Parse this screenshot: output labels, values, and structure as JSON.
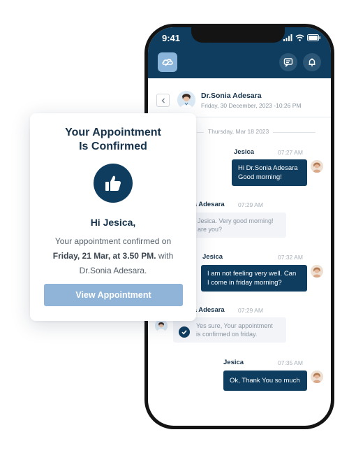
{
  "status_bar": {
    "time": "9:41"
  },
  "chat_header": {
    "doctor_name": "Dr.Sonia Adesara",
    "datetime": "Friday, 30 December, 2023 -10:26 PM"
  },
  "chat": {
    "day_label": "Thursday, Mar 18 2023",
    "messages": [
      {
        "sender": "Jesica",
        "time": "07:27 AM",
        "lines": [
          "Hi Dr.Sonia Adesara",
          "Good morning!"
        ]
      },
      {
        "sender": "ia Adesara",
        "time": "07:29 AM",
        "lines": [
          "Jesica. Very good morning!",
          "are you?"
        ]
      },
      {
        "sender": "Jesica",
        "time": "07:32 AM",
        "lines": [
          "I am not feeling very well. Can",
          "I come in friday morning?"
        ]
      },
      {
        "sender": "ia Adesara",
        "time": "07:29 AM",
        "lines": [
          "Yes sure, Your appointment",
          "is confirmed on friday."
        ]
      },
      {
        "sender": "Jesica",
        "time": "07:35 AM",
        "lines": [
          "Ok, Thank You so much"
        ]
      }
    ]
  },
  "card": {
    "title_line1": "Your Appointment",
    "title_line2": "Is Confirmed",
    "greeting": "Hi Jesica,",
    "text_pre": "Your appointment confirmed on",
    "text_bold": "Friday, 21 Mar, at 3.50 PM.",
    "text_mid": " with",
    "text_end": "Dr.Sonia Adesara.",
    "button_label": "View Appointment"
  },
  "colors": {
    "primary": "#0f3d5f",
    "button": "#8fb4d8",
    "logo_bg": "#8ab4d9"
  },
  "icons": [
    "thumbs-up-icon",
    "chat-icon",
    "bell-icon",
    "chevron-left-icon",
    "check-icon",
    "signal-icon",
    "wifi-icon",
    "battery-icon",
    "app-logo-icon"
  ]
}
